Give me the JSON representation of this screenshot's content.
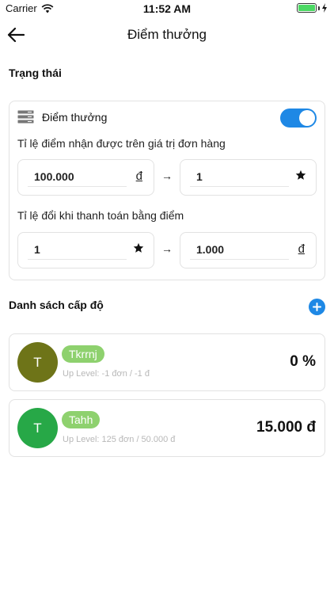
{
  "status_bar": {
    "carrier": "Carrier",
    "time": "11:52 AM"
  },
  "nav": {
    "title": "Điểm thưởng"
  },
  "status_section": {
    "title": "Trạng thái",
    "reward_label": "Điểm thưởng",
    "reward_enabled": true,
    "earn_label": "Tỉ lệ điểm nhận được trên giá trị đơn hàng",
    "earn_amount": "100.000",
    "earn_amount_unit": "đ",
    "earn_points": "1",
    "redeem_label": "Tỉ lệ đổi khi thanh toán bằng điểm",
    "redeem_points": "1",
    "redeem_amount": "1.000",
    "redeem_amount_unit": "đ",
    "arrow": "→"
  },
  "levels_section": {
    "title": "Danh sách cấp độ",
    "items": [
      {
        "initial": "T",
        "name": "Tkrrnj",
        "up_level": "Up Level: -1 đơn / -1 đ",
        "value": "0 %",
        "color": "#6e7418"
      },
      {
        "initial": "T",
        "name": "Tahh",
        "up_level": "Up Level: 125 đơn / 50.000 đ",
        "value": "15.000 đ",
        "color": "#27a847"
      }
    ]
  },
  "colors": {
    "accent": "#1e88e5",
    "badge": "#8ed16e"
  }
}
